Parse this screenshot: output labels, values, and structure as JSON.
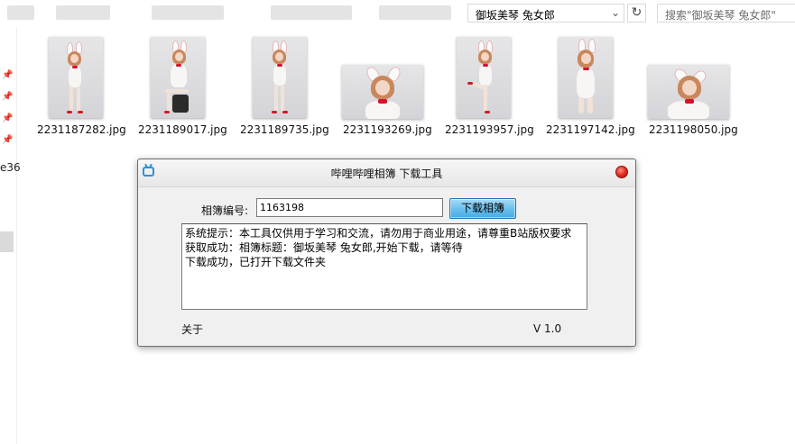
{
  "explorer": {
    "address_text": "御坂美琴 兔女郎",
    "search_placeholder": "搜索\"御坂美琴 兔女郎\"",
    "chevron_icon": "chevron-down-icon",
    "refresh_icon": "refresh-icon",
    "nav_fragment": "e36"
  },
  "files": [
    {
      "name": "2231187282.jpg"
    },
    {
      "name": "2231189017.jpg"
    },
    {
      "name": "2231189735.jpg"
    },
    {
      "name": "2231193269.jpg"
    },
    {
      "name": "2231193957.jpg"
    },
    {
      "name": "2231197142.jpg"
    },
    {
      "name": "2231198050.jpg"
    }
  ],
  "dialog": {
    "title": "哔哩哔哩相簿 下载工具",
    "field_label": "相簿编号:",
    "album_id": "1163198",
    "download_button": "下载相簿",
    "log": [
      "系统提示：本工具仅供用于学习和交流，请勿用于商业用途，请尊重B站版权要求",
      "获取成功：相簿标题：御坂美琴 兔女郎,开始下载，请等待",
      "下载成功，已打开下载文件夹"
    ],
    "about": "关于",
    "version": "V 1.0"
  },
  "colors": {
    "button_accent": "#6cc1ee",
    "close_red": "#e0261a",
    "bow_red": "#d8102a"
  }
}
